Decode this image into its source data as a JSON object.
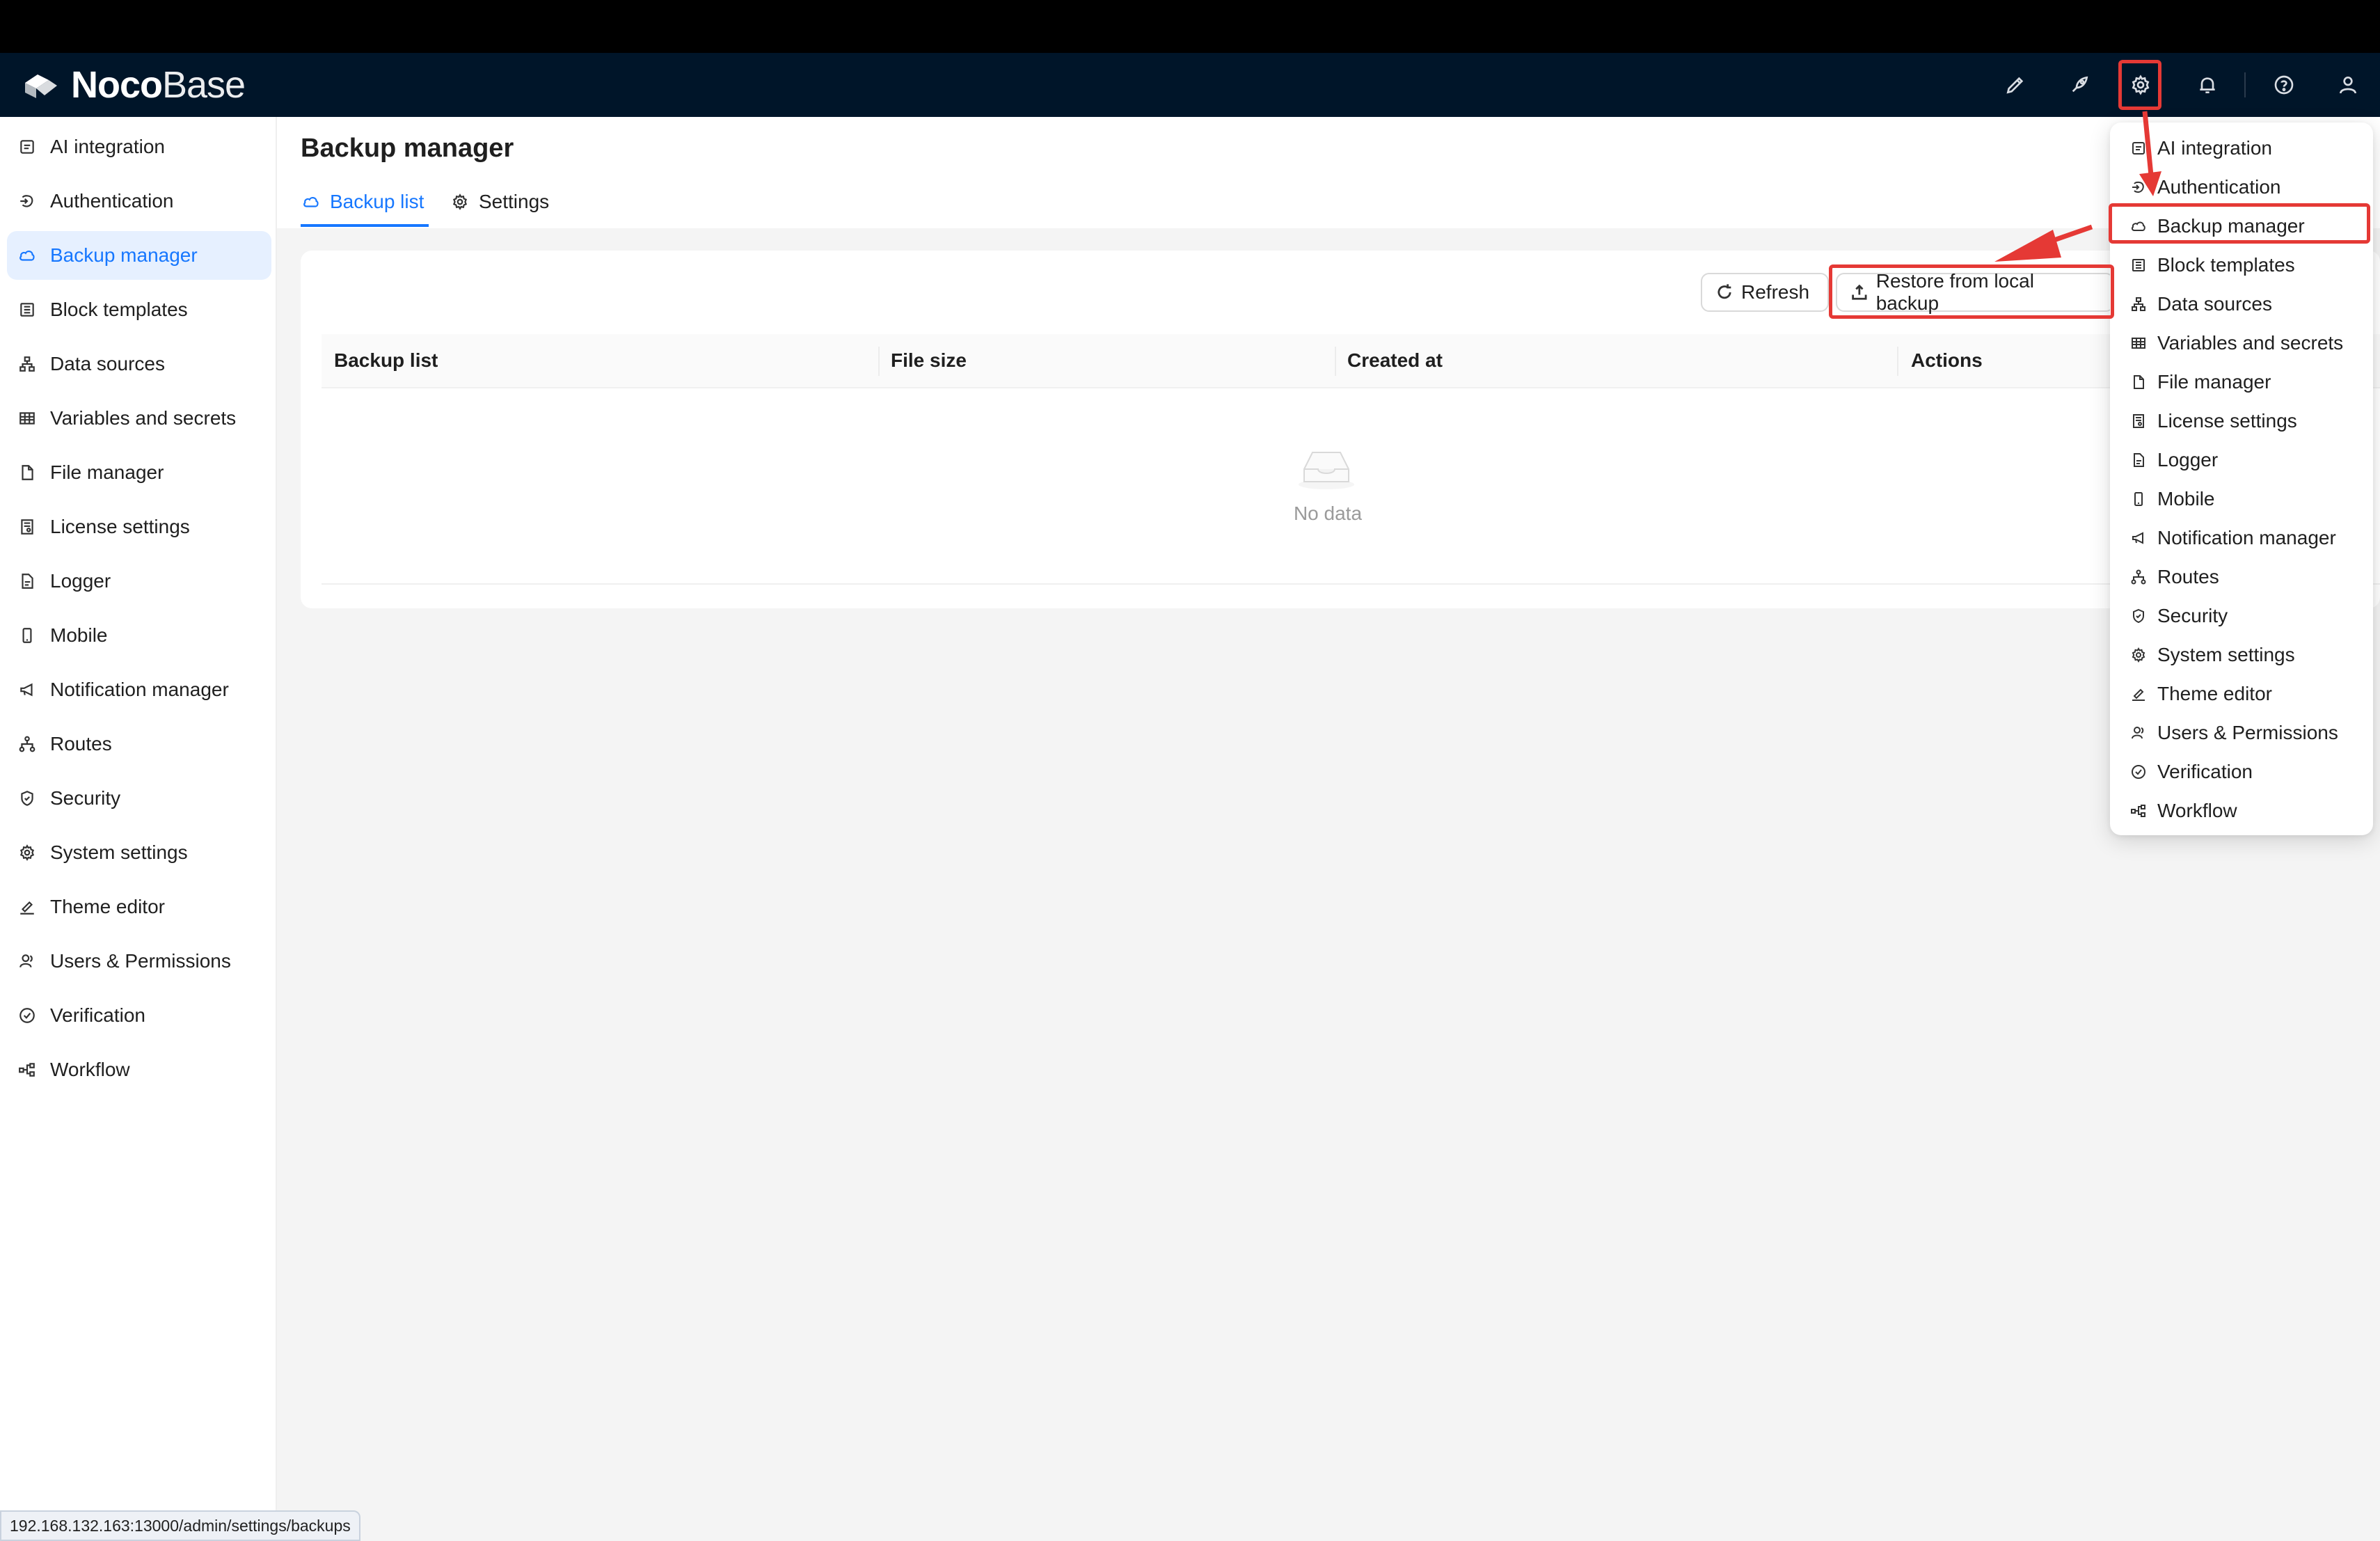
{
  "app": {
    "logo_bold": "Noco",
    "logo_light": "Base"
  },
  "header_icons": [
    "theme-brush-icon",
    "plugin-rocket-icon",
    "settings-gear-icon",
    "notification-bell-icon",
    "help-circle-icon",
    "user-icon"
  ],
  "sidebar": {
    "items": [
      {
        "label": "AI integration",
        "icon": "ai-icon"
      },
      {
        "label": "Authentication",
        "icon": "login-icon"
      },
      {
        "label": "Backup manager",
        "icon": "cloud-icon",
        "active": true
      },
      {
        "label": "Block templates",
        "icon": "layout-icon"
      },
      {
        "label": "Data sources",
        "icon": "cluster-icon"
      },
      {
        "label": "Variables and secrets",
        "icon": "table-icon"
      },
      {
        "label": "File manager",
        "icon": "file-icon"
      },
      {
        "label": "License settings",
        "icon": "license-icon"
      },
      {
        "label": "Logger",
        "icon": "file-text-icon"
      },
      {
        "label": "Mobile",
        "icon": "mobile-icon"
      },
      {
        "label": "Notification manager",
        "icon": "megaphone-icon"
      },
      {
        "label": "Routes",
        "icon": "routes-icon"
      },
      {
        "label": "Security",
        "icon": "shield-icon"
      },
      {
        "label": "System settings",
        "icon": "gear-icon"
      },
      {
        "label": "Theme editor",
        "icon": "brush-icon"
      },
      {
        "label": "Users & Permissions",
        "icon": "users-icon"
      },
      {
        "label": "Verification",
        "icon": "check-circle-icon"
      },
      {
        "label": "Workflow",
        "icon": "workflow-icon"
      }
    ]
  },
  "page": {
    "title": "Backup manager",
    "tabs": [
      {
        "label": "Backup list",
        "active": true
      },
      {
        "label": "Settings"
      }
    ],
    "toolbar": {
      "refresh_label": "Refresh",
      "restore_label": "Restore from local backup"
    },
    "table": {
      "columns": [
        "Backup list",
        "File size",
        "Created at",
        "Actions"
      ],
      "rows": [],
      "empty_text": "No data"
    }
  },
  "dropdown": {
    "items": [
      "AI integration",
      "Authentication",
      "Backup manager",
      "Block templates",
      "Data sources",
      "Variables and secrets",
      "File manager",
      "License settings",
      "Logger",
      "Mobile",
      "Notification manager",
      "Routes",
      "Security",
      "System settings",
      "Theme editor",
      "Users & Permissions",
      "Verification",
      "Workflow"
    ]
  },
  "status_bar": {
    "url": "192.168.132.163:13000/admin/settings/backups"
  },
  "colors": {
    "header_bg": "#001529",
    "accent": "#1677ff",
    "highlight": "#e53935",
    "active_bg": "#e6f0ff"
  }
}
